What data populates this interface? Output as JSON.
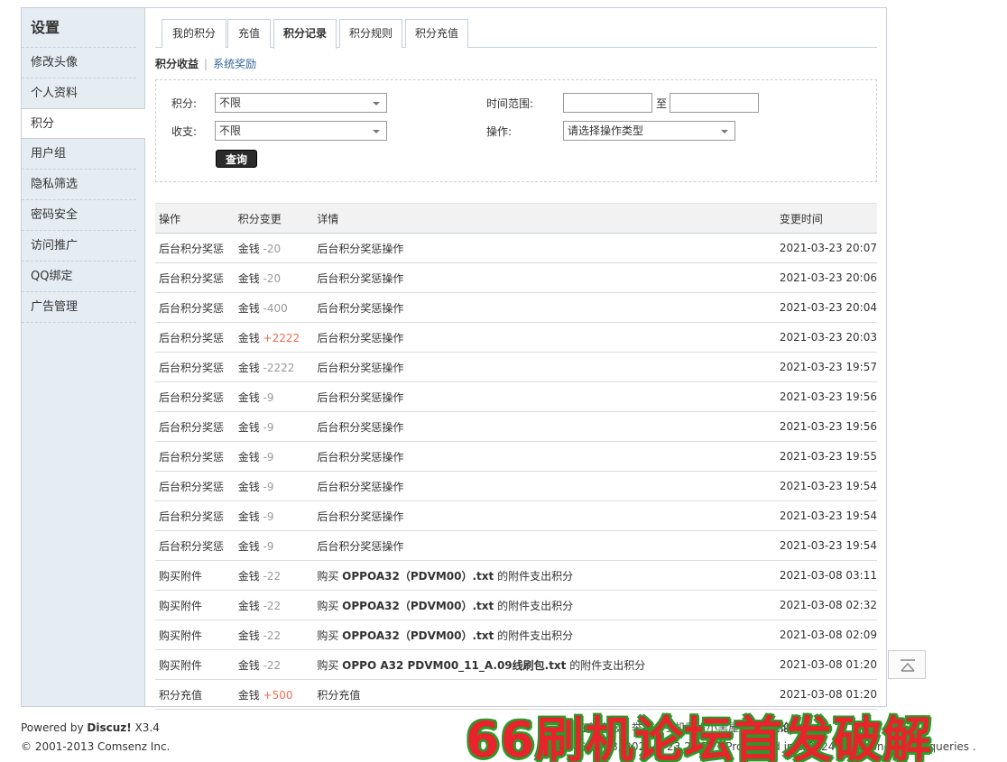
{
  "sidebar": {
    "title": "设置",
    "items": [
      {
        "label": "修改头像"
      },
      {
        "label": "个人资料"
      },
      {
        "label": "积分"
      },
      {
        "label": "用户组"
      },
      {
        "label": "隐私筛选"
      },
      {
        "label": "密码安全"
      },
      {
        "label": "访问推广"
      },
      {
        "label": "QQ绑定"
      },
      {
        "label": "广告管理"
      }
    ],
    "active_index": 2
  },
  "tabs": [
    {
      "label": "我的积分"
    },
    {
      "label": "充值"
    },
    {
      "label": "积分记录"
    },
    {
      "label": "积分规则"
    },
    {
      "label": "积分充值"
    }
  ],
  "active_tab": 2,
  "subnav": {
    "current": "积分收益",
    "separator": "|",
    "link": "系统奖励"
  },
  "filter": {
    "credit_label": "积分:",
    "credit_value": "不限",
    "io_label": "收支:",
    "io_value": "不限",
    "time_label": "时间范围:",
    "time_to": "至",
    "op_label": "操作:",
    "op_value": "请选择操作类型",
    "query_label": "查询"
  },
  "table": {
    "headers": {
      "op": "操作",
      "change": "积分变更",
      "detail": "详情",
      "time": "变更时间"
    },
    "rows": [
      {
        "op": "后台积分奖惩",
        "unit": "金钱",
        "delta": "-20",
        "sign": "neg",
        "detail": "后台积分奖惩操作",
        "time": "2021-03-23 20:07"
      },
      {
        "op": "后台积分奖惩",
        "unit": "金钱",
        "delta": "-20",
        "sign": "neg",
        "detail": "后台积分奖惩操作",
        "time": "2021-03-23 20:06"
      },
      {
        "op": "后台积分奖惩",
        "unit": "金钱",
        "delta": "-400",
        "sign": "neg",
        "detail": "后台积分奖惩操作",
        "time": "2021-03-23 20:04"
      },
      {
        "op": "后台积分奖惩",
        "unit": "金钱",
        "delta": "+2222",
        "sign": "pos",
        "detail": "后台积分奖惩操作",
        "time": "2021-03-23 20:03"
      },
      {
        "op": "后台积分奖惩",
        "unit": "金钱",
        "delta": "-2222",
        "sign": "neg",
        "detail": "后台积分奖惩操作",
        "time": "2021-03-23 19:57"
      },
      {
        "op": "后台积分奖惩",
        "unit": "金钱",
        "delta": "-9",
        "sign": "neg",
        "detail": "后台积分奖惩操作",
        "time": "2021-03-23 19:56"
      },
      {
        "op": "后台积分奖惩",
        "unit": "金钱",
        "delta": "-9",
        "sign": "neg",
        "detail": "后台积分奖惩操作",
        "time": "2021-03-23 19:56"
      },
      {
        "op": "后台积分奖惩",
        "unit": "金钱",
        "delta": "-9",
        "sign": "neg",
        "detail": "后台积分奖惩操作",
        "time": "2021-03-23 19:55"
      },
      {
        "op": "后台积分奖惩",
        "unit": "金钱",
        "delta": "-9",
        "sign": "neg",
        "detail": "后台积分奖惩操作",
        "time": "2021-03-23 19:54"
      },
      {
        "op": "后台积分奖惩",
        "unit": "金钱",
        "delta": "-9",
        "sign": "neg",
        "detail": "后台积分奖惩操作",
        "time": "2021-03-23 19:54"
      },
      {
        "op": "后台积分奖惩",
        "unit": "金钱",
        "delta": "-9",
        "sign": "neg",
        "detail": "后台积分奖惩操作",
        "time": "2021-03-23 19:54"
      },
      {
        "op": "购买附件",
        "unit": "金钱",
        "delta": "-22",
        "sign": "neg",
        "detail_pre": "购买 ",
        "detail_file": "OPPOA32（PDVM00）.txt",
        "detail_post": " 的附件支出积分",
        "time": "2021-03-08 03:11"
      },
      {
        "op": "购买附件",
        "unit": "金钱",
        "delta": "-22",
        "sign": "neg",
        "detail_pre": "购买 ",
        "detail_file": "OPPOA32（PDVM00）.txt",
        "detail_post": " 的附件支出积分",
        "time": "2021-03-08 02:32"
      },
      {
        "op": "购买附件",
        "unit": "金钱",
        "delta": "-22",
        "sign": "neg",
        "detail_pre": "购买 ",
        "detail_file": "OPPOA32（PDVM00）.txt",
        "detail_post": " 的附件支出积分",
        "time": "2021-03-08 02:09"
      },
      {
        "op": "购买附件",
        "unit": "金钱",
        "delta": "-22",
        "sign": "neg",
        "detail_pre": "购买 ",
        "detail_file": "OPPO A32 PDVM00_11_A.09线刷包.txt",
        "detail_post": " 的附件支出积分",
        "time": "2021-03-08 01:20"
      },
      {
        "op": "积分充值",
        "unit": "金钱",
        "delta": "+500",
        "sign": "pos",
        "detail": "积分充值",
        "time": "2021-03-08 01:20"
      }
    ]
  },
  "footer": {
    "powered_by": "Powered by ",
    "brand": "Discuz!",
    "version": " X3.4",
    "copyright": "© 2001-2013 Comsenz Inc.",
    "right_line1_a": "在线客服",
    "right_line1_b": "举报",
    "right_line1_c": "手机版",
    "right_line1_d": "小黑屋",
    "right_site": "66刷机论坛",
    "right_line2": "GMT+8, 2021-3-23 21:39 , Processed in 0.052462 second(s), 16 queries ."
  },
  "watermark": "66刷机论坛首发破解",
  "colors": {
    "positive": "#f26c4f",
    "negative": "#999999",
    "sidebar_bg": "#e5edf2",
    "button_bg": "#2b2b2b"
  }
}
